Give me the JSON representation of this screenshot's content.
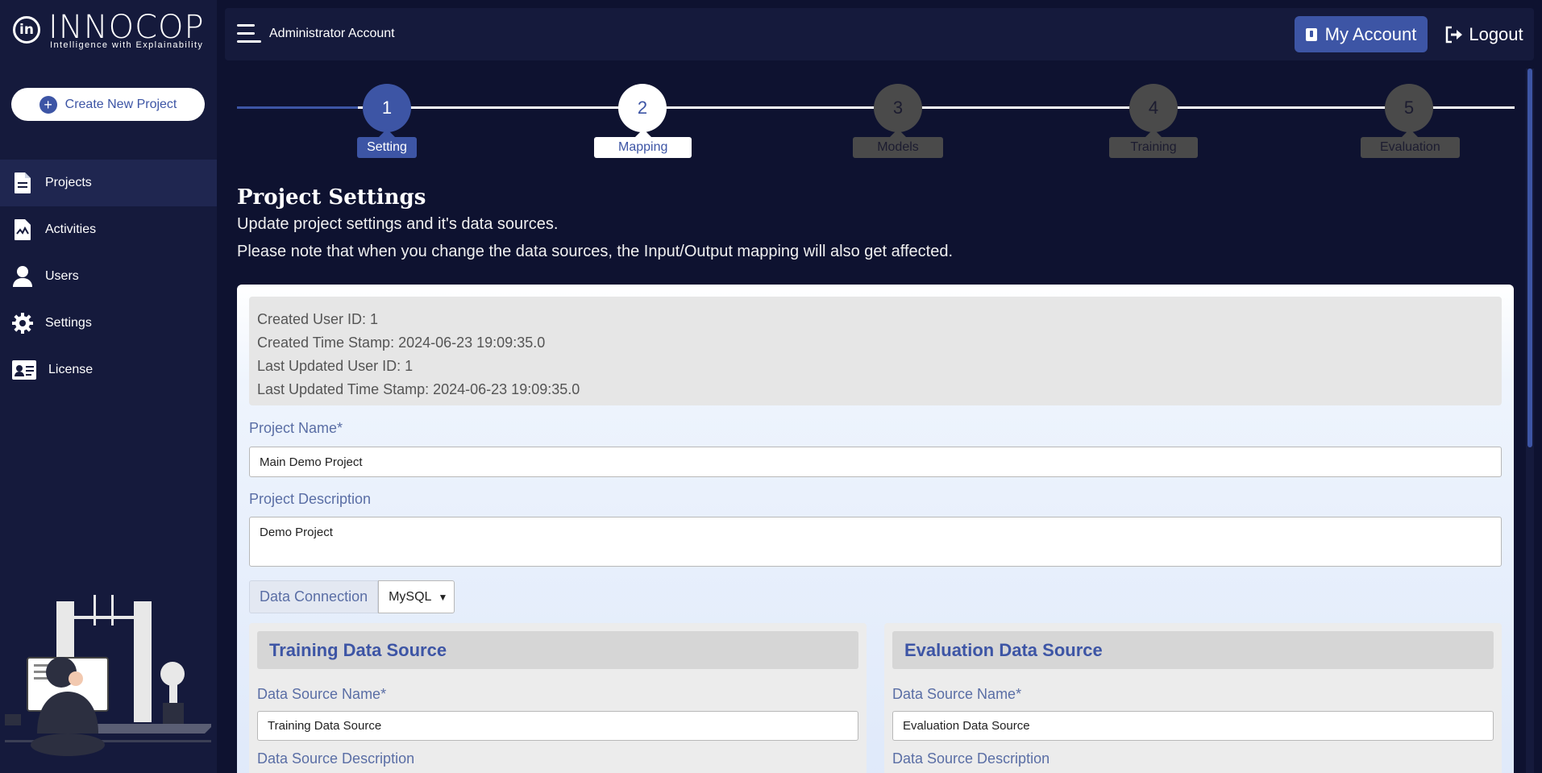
{
  "brand": {
    "name": "INNOCOP",
    "tagline": "Intelligence with Explainability",
    "mark": "in"
  },
  "sidebar": {
    "create_button": "Create New Project",
    "items": [
      {
        "label": "Projects",
        "icon": "document-icon",
        "active": true
      },
      {
        "label": "Activities",
        "icon": "activity-icon",
        "active": false
      },
      {
        "label": "Users",
        "icon": "user-icon",
        "active": false
      },
      {
        "label": "Settings",
        "icon": "gear-icon",
        "active": false
      },
      {
        "label": "License",
        "icon": "id-card-icon",
        "active": false
      }
    ]
  },
  "header": {
    "title": "Administrator Account",
    "account_button": "My Account",
    "logout_button": "Logout"
  },
  "stepper": {
    "steps": [
      {
        "number": "1",
        "label": "Setting",
        "state": "active"
      },
      {
        "number": "2",
        "label": "Mapping",
        "state": "next"
      },
      {
        "number": "3",
        "label": "Models",
        "state": "disabled"
      },
      {
        "number": "4",
        "label": "Training",
        "state": "disabled"
      },
      {
        "number": "5",
        "label": "Evaluation",
        "state": "disabled"
      }
    ]
  },
  "page": {
    "title": "Project Settings",
    "description_1": "Update project settings and it's data sources.",
    "description_2": "Please note that when you change the data sources, the Input/Output mapping will also get affected."
  },
  "meta": {
    "created_user": "Created User ID: 1",
    "created_time": "Created Time Stamp: 2024-06-23 19:09:35.0",
    "updated_user": "Last Updated User ID: 1",
    "updated_time": "Last Updated Time Stamp: 2024-06-23 19:09:35.0"
  },
  "form": {
    "project_name_label": "Project Name*",
    "project_name_value": "Main Demo Project",
    "project_desc_label": "Project Description",
    "project_desc_value": "Demo Project",
    "connection_label": "Data Connection",
    "connection_value": "MySQL"
  },
  "training_source": {
    "heading": "Training Data Source",
    "name_label": "Data Source Name*",
    "name_value": "Training Data Source",
    "desc_label": "Data Source Description"
  },
  "evaluation_source": {
    "heading": "Evaluation Data Source",
    "name_label": "Data Source Name*",
    "name_value": "Evaluation Data Source",
    "desc_label": "Data Source Description"
  },
  "colors": {
    "background": "#0e1230",
    "sidebar": "#151a3c",
    "accent": "#3d55a5",
    "step_disabled": "#4a4a4a"
  }
}
